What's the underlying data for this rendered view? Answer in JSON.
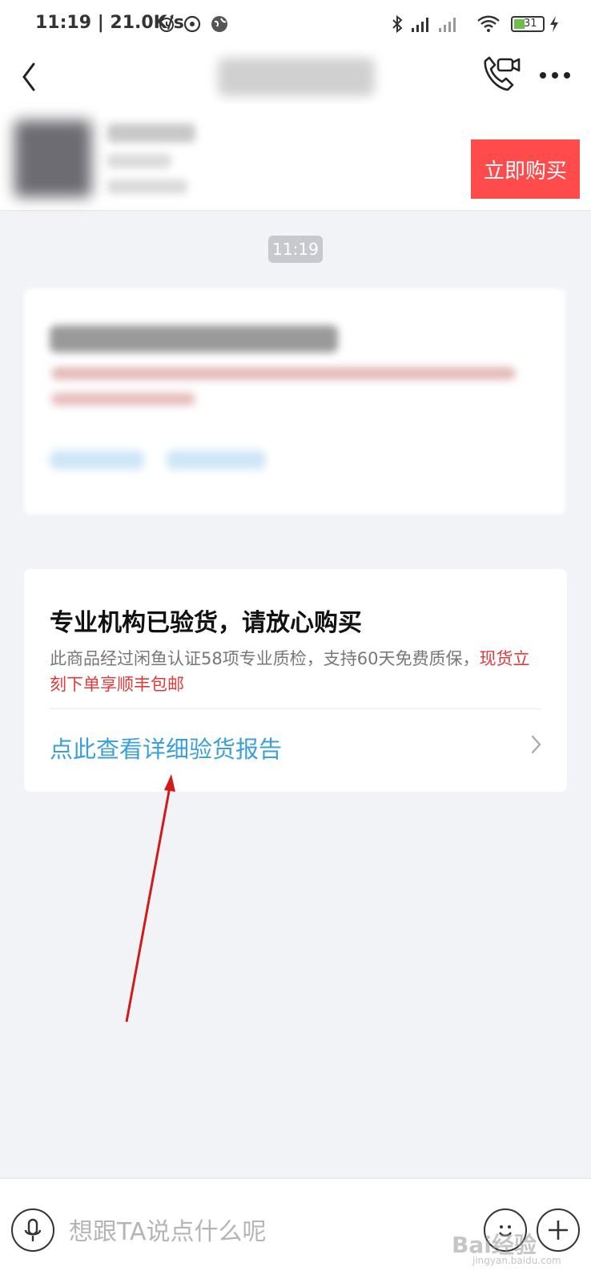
{
  "status_bar": {
    "text": "11:19 | 21.0K/s",
    "battery": "31",
    "icons": [
      "alarm-icon",
      "sync-icon",
      "globe-icon",
      "bluetooth-icon",
      "signal-icon",
      "signal-icon",
      "wifi-icon",
      "battery-icon",
      "charging-icon"
    ]
  },
  "nav": {
    "back_icon": "chevron-left-icon",
    "call_icon": "phone-video-icon",
    "more_icon": "more-icon"
  },
  "product_bar": {
    "buy_label": "立即购买",
    "buy_color": "#ff4b4b"
  },
  "chat": {
    "time": "11:19"
  },
  "inspection_card": {
    "title": "专业机构已验货，请放心购买",
    "desc_gray": "此商品经过闲鱼认证58项专业质检，支持60天免费质保，",
    "desc_red": "现货立刻下单享顺丰包邮",
    "link_label": "点此查看详细验货报告",
    "link_color": "#3aa0d8",
    "accent_red": "#e03b3b"
  },
  "input_bar": {
    "placeholder": "想跟TA说点什么呢",
    "mic_icon": "microphone-icon",
    "emoji_icon": "emoji-icon",
    "plus_icon": "plus-icon"
  },
  "watermark": {
    "text": "Bai经验",
    "sub": "jingyan.baidu.com"
  }
}
